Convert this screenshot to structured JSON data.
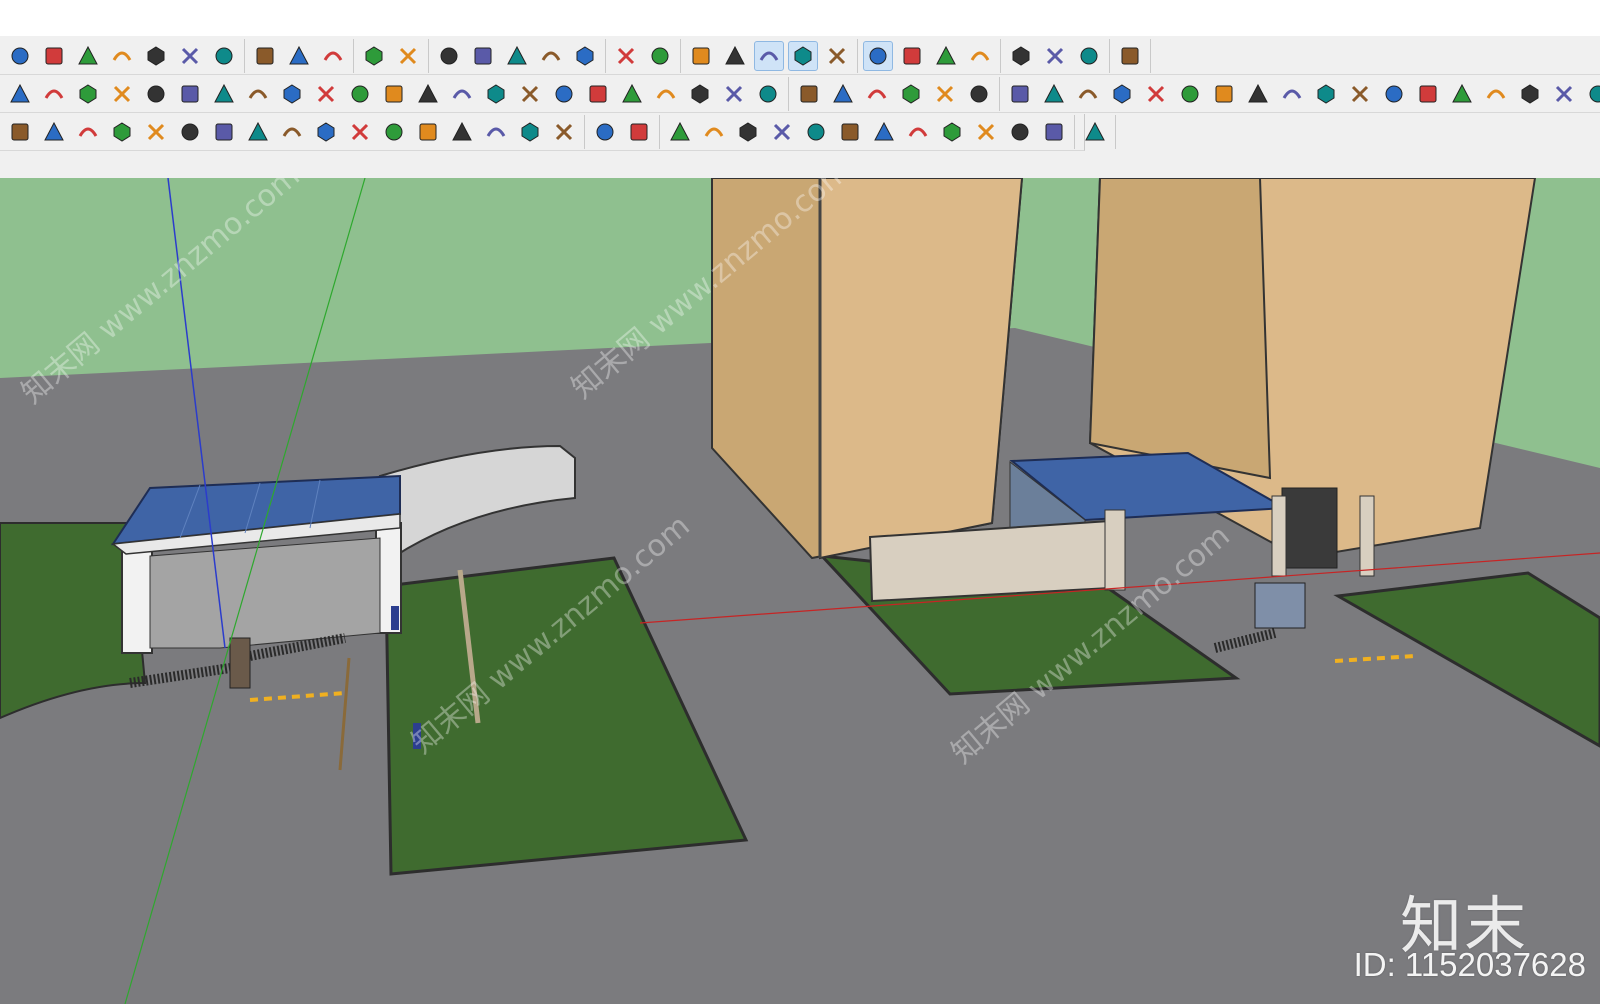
{
  "toolbars": {
    "row1": [
      [
        "undo-redo-icon",
        "add-circle-icon",
        "tree-icon",
        "layer-sun-icon",
        "checker-ball-icon",
        "cloud-upload-icon",
        "gear-icon"
      ],
      [
        "mail-icon",
        "info-icon",
        "user-icon"
      ],
      [
        "texture-icon",
        "grid-sheet-icon"
      ],
      [
        "gem-icon",
        "pyramid-icon",
        "cup-icon",
        "terrain-icon",
        "wedge-icon"
      ],
      [
        "box-solid-icon",
        "box-paper-icon"
      ],
      [
        "box-open-icon",
        "plane-icon",
        "slab-icon",
        "stack-icon",
        "tile-icon"
      ],
      [
        "cloud-wave-icon",
        "cloud-link-icon",
        "cloud-outline-icon",
        "cloud-lines-icon"
      ],
      [
        "frame-icon",
        "flower-icon",
        "refresh-check-icon"
      ],
      [
        "chrome-ring-icon"
      ]
    ],
    "row2": [
      [
        "push-pipe-icon",
        "pipe-icon",
        "path-follow-icon",
        "spiral-icon",
        "loop-icon",
        "curve-icon",
        "curve-plus-icon",
        "curve-wave-icon",
        "stair-icon",
        "drop-red-icon",
        "arrows-red-icon",
        "arc-icon",
        "bar-icon",
        "wood-icon",
        "cabinet-icon",
        "cog-icon",
        "shield-blue-icon",
        "shield-red-icon",
        "lock-icon",
        "leaf-icon",
        "paper-icon",
        "arrow-red-icon",
        "basket-icon"
      ],
      [
        "house-top-icon",
        "door-icon",
        "house-icon",
        "house-window-icon",
        "house-outline-icon",
        "house-dark-icon"
      ],
      [
        "clipboard-icon",
        "pen-edit-icon",
        "dxf-icon",
        "image-icon",
        "bulb-icon",
        "hex-icon",
        "cube-icon",
        "magnify-icon",
        "spring-icon",
        "orange-grid-icon",
        "red-grid-icon",
        "mixed-grid-icon",
        "white-grid-icon",
        "teal-grid-icon",
        "box-3d-icon",
        "layers-icon",
        "shade-add-icon",
        "texture-fill-icon"
      ]
    ],
    "row3": [
      [
        "cube-blue-icon",
        "list-icon",
        "wiggle-icon",
        "wand-icon",
        "measure-icon",
        "mirror-icon",
        "rotate-x-icon",
        "rotate-y-icon",
        "rotate-z-icon",
        "rotate-r-icon",
        "rotate-v-icon",
        "slash-icon",
        "cube-red-icon",
        "cube-blue2-icon",
        "arc-bridge-icon",
        "leaf-blue-icon",
        "corner-icon"
      ],
      [
        "s-curve-green-icon",
        "s-curve-red-icon"
      ],
      [
        "bool-union-icon",
        "bool-subtract-icon",
        "bool-intersect-icon",
        "bool-outline-icon",
        "bool-split-icon",
        "bool-trim-icon",
        "grid-blue-icon",
        "wall-blue-icon",
        "roof-icon",
        "roof-outline-icon",
        "panel-icon",
        "barrel-icon"
      ],
      [
        "logo-orange-icon"
      ]
    ]
  },
  "active_tools": [
    "slab-icon",
    "stack-icon",
    "cloud-wave-icon"
  ],
  "colors": {
    "sky": "#8fc08f",
    "ground": "#7b7b7e",
    "lawn": "#3f6b2f",
    "building": "#dcb989",
    "roof_glass": "#3f64a6",
    "axis_blue": "#2b3ccc",
    "axis_green": "#2ea82e",
    "axis_red": "#c72424"
  },
  "watermark": {
    "brand": "知末",
    "id_text": "ID: 1152037628",
    "diagonal_text": "知末网 www.znzmo.com"
  }
}
